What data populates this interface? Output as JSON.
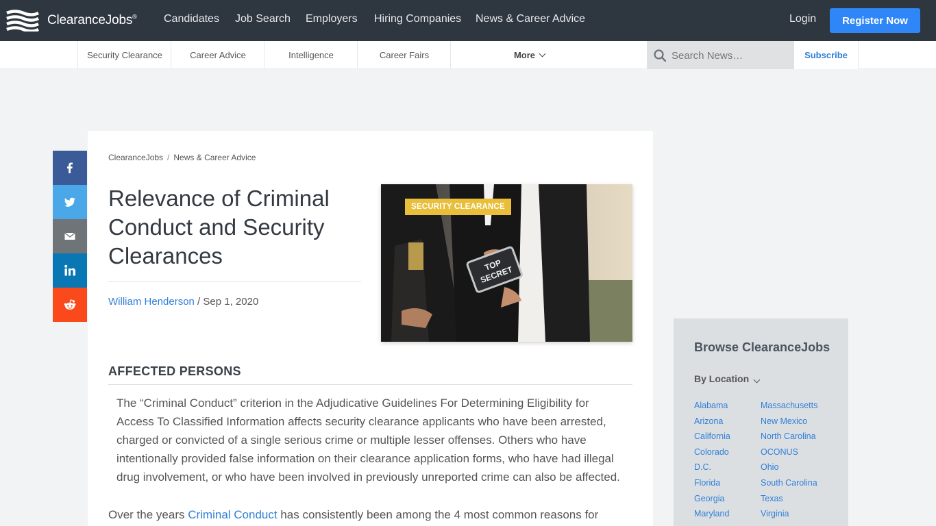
{
  "brand": {
    "name": "ClearanceJobs",
    "mark": "®"
  },
  "nav": {
    "items": [
      "Candidates",
      "Job Search",
      "Employers",
      "Hiring Companies",
      "News & Career Advice"
    ],
    "login": "Login",
    "register": "Register Now"
  },
  "subnav": {
    "items": [
      "Security Clearance",
      "Career Advice",
      "Intelligence",
      "Career Fairs"
    ],
    "more": "More",
    "search_placeholder": "Search News…",
    "subscribe": "Subscribe"
  },
  "share": [
    "facebook",
    "twitter",
    "email",
    "linkedin",
    "reddit"
  ],
  "article": {
    "breadcrumb": [
      "ClearanceJobs",
      "News & Career Advice"
    ],
    "breadcrumb_sep": "/",
    "title": "Relevance of Criminal Conduct and Security Clearances",
    "author": "William Henderson",
    "byline_sep": " / ",
    "date": "Sep 1, 2020",
    "tag": "SECURITY CLEARANCE",
    "hero_text": "TOP SECRET",
    "section_heading": "AFFECTED PERSONS",
    "quote": "The “Criminal Conduct” criterion in the Adjudicative Guidelines For Determining Eligibility for Access To Classified Information affects security clearance applicants who have been arrested, charged or convicted of a single serious crime or multiple lesser offenses. Others who have intentionally provided false information on their clearance application forms, who have had illegal drug involvement, or who have been involved in previously unreported crime can also be affected.",
    "para_before": "Over the years ",
    "para_link": "Criminal Conduct",
    "para_after": " has consistently been among the 4 most common reasons for"
  },
  "browse": {
    "heading": "Browse ClearanceJobs",
    "filter": "By Location",
    "col1": [
      "Alabama",
      "Arizona",
      "California",
      "Colorado",
      "D.C.",
      "Florida",
      "Georgia",
      "Maryland"
    ],
    "col2": [
      "Massachusetts",
      "New Mexico",
      "North Carolina",
      "OCONUS",
      "Ohio",
      "South Carolina",
      "Texas",
      "Virginia"
    ]
  },
  "colors": {
    "topbar": "#2e3640",
    "accent": "#2f86f6",
    "link": "#2f7fd8",
    "tag": "#e8be3a"
  }
}
